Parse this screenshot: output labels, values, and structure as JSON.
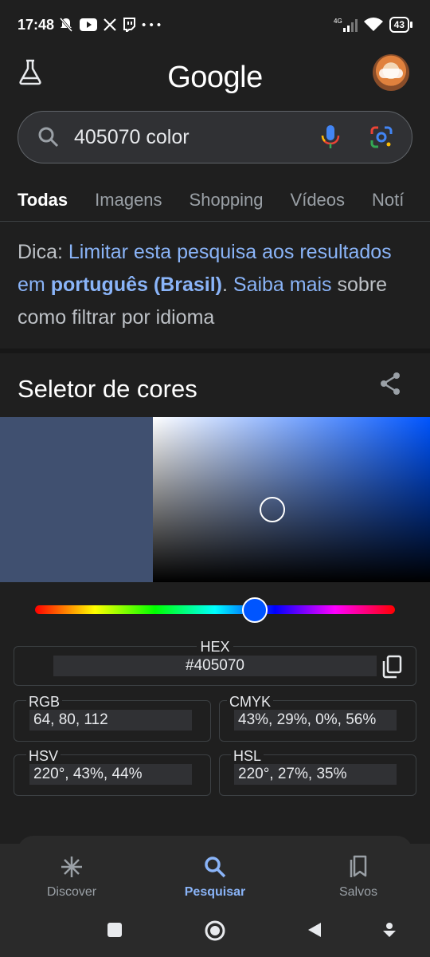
{
  "status_bar": {
    "time": "17:48",
    "left_icons": [
      "mute-bell-icon",
      "youtube-icon",
      "x-icon",
      "twitch-icon",
      "more-dots"
    ],
    "right_icons": [
      "4g-signal-icon",
      "wifi-icon"
    ],
    "battery": "43"
  },
  "header": {
    "logo": "Google",
    "labs_icon": "flask-icon",
    "avatar": "profile-avatar"
  },
  "search": {
    "query": "405070 color",
    "icons": [
      "search-icon",
      "mic-icon",
      "lens-icon"
    ]
  },
  "tabs": [
    {
      "label": "Todas",
      "active": true
    },
    {
      "label": "Imagens",
      "active": false
    },
    {
      "label": "Shopping",
      "active": false
    },
    {
      "label": "Vídeos",
      "active": false
    },
    {
      "label": "Notí",
      "active": false
    }
  ],
  "tip": {
    "prefix": "Dica: ",
    "link1": "Limitar esta pesquisa aos resultados em ",
    "link1_bold": "português (Brasil)",
    "sep": ". ",
    "link2": "Saiba mais",
    "suffix": " sobre como filtrar por idioma"
  },
  "color_picker": {
    "title": "Seletor de cores",
    "swatch_color": "#405070",
    "hue_color": "#0055ff",
    "thumb_color": "#0055ff",
    "sv_cursor": {
      "saturation": 0.43,
      "value": 0.44
    },
    "hue_fraction": 0.61,
    "hex_label": "HEX",
    "hex_value": "#405070",
    "rgb_label": "RGB",
    "rgb_value": "64, 80, 112",
    "cmyk_label": "CMYK",
    "cmyk_value": "43%, 29%, 0%, 56%",
    "hsv_label": "HSV",
    "hsv_value": "220°, 43%, 44%",
    "hsl_label": "HSL",
    "hsl_value": "220°, 27%, 35%"
  },
  "bottom_nav": {
    "items": [
      {
        "label": "Discover",
        "icon": "asterisk-icon",
        "active": false
      },
      {
        "label": "Pesquisar",
        "icon": "search-icon",
        "active": true
      },
      {
        "label": "Salvos",
        "icon": "saved-icon",
        "active": false
      }
    ]
  },
  "system_nav": [
    "square-icon",
    "home-circle-icon",
    "back-triangle-icon",
    "assistant-icon"
  ],
  "colors": {
    "background": "#1f1f1f",
    "accent": "#8ab4f8",
    "text": "#e8eaed",
    "muted": "#9aa0a6"
  }
}
